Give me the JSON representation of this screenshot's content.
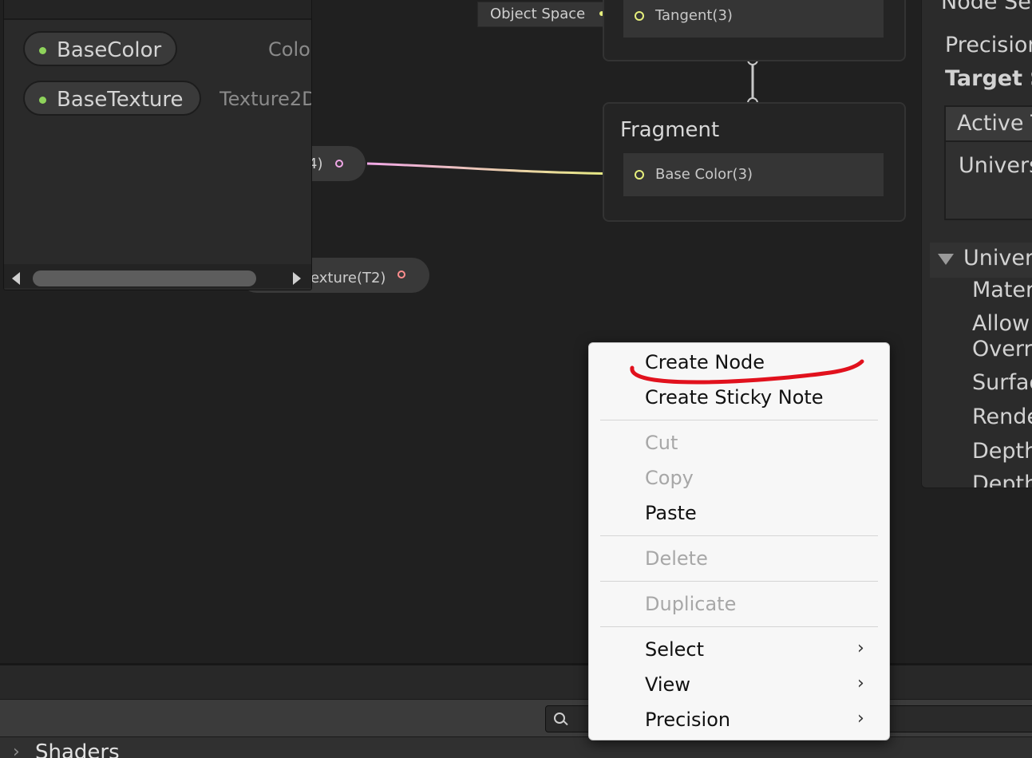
{
  "blackboard": {
    "properties": [
      {
        "name": "BaseColor",
        "type": "Colo"
      },
      {
        "name": "BaseTexture",
        "type": "Texture2D"
      }
    ]
  },
  "graph": {
    "color_node_output": "4)",
    "texture_node_output": "exture(T2)",
    "object_space_label": "Object Space",
    "vertex_slot_label": "Tangent(3)",
    "fragment": {
      "title": "Fragment",
      "slot_label": "Base Color(3)"
    }
  },
  "inspector": {
    "header": "Node Set",
    "precision": "Precision",
    "target_settings": "Target S",
    "active_targets": "Active T",
    "universal": "Univers",
    "universal_fold": "Univers",
    "fields": [
      "Mater",
      "Allow",
      "Overri",
      "Surfac",
      "Rende",
      "Depth",
      "Depth"
    ]
  },
  "bottom": {
    "project_item": "Shaders"
  },
  "context_menu": {
    "items": [
      {
        "label": "Create Node",
        "enabled": true,
        "annotated": true
      },
      {
        "label": "Create Sticky Note",
        "enabled": true
      },
      {
        "label": "Cut",
        "enabled": false
      },
      {
        "label": "Copy",
        "enabled": false
      },
      {
        "label": "Paste",
        "enabled": true
      },
      {
        "label": "Delete",
        "enabled": false
      },
      {
        "label": "Duplicate",
        "enabled": false
      },
      {
        "label": "Select",
        "enabled": true,
        "submenu": true
      },
      {
        "label": "View",
        "enabled": true,
        "submenu": true
      },
      {
        "label": "Precision",
        "enabled": true,
        "submenu": true
      }
    ],
    "submenu_arrow": "›"
  },
  "colors": {
    "background": "#202020",
    "property_dot": "#8ed35b",
    "vector_port": "#e6ef7c",
    "color_port": "#f0a7e6",
    "texture_port": "#ff8e8e",
    "annotation_stroke": "#e1111d",
    "menu_bg": "#f7f7f7"
  }
}
